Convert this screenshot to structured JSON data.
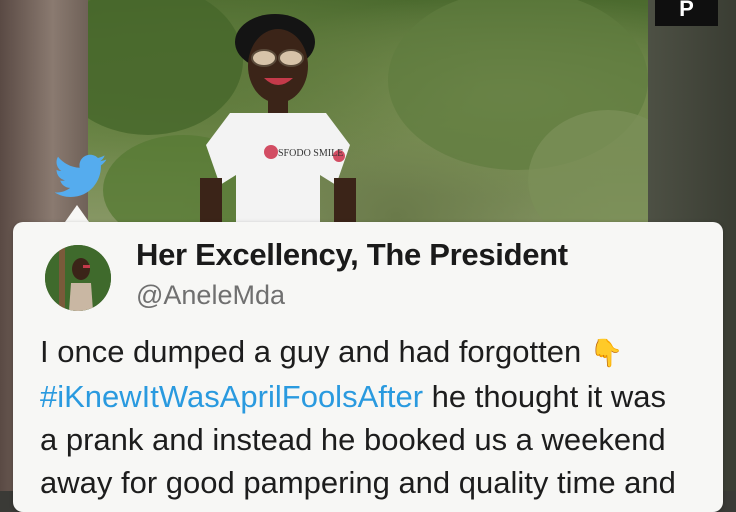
{
  "header_badge": {
    "label": "P"
  },
  "tweet": {
    "display_name": "Her Excellency, The President",
    "handle": "@AneleMda",
    "lines": [
      {
        "text": "I once dumped a guy and had forgotten ",
        "emoji": "👇"
      },
      {
        "hashtag": "#iKnewItWasAprilFoolsAfter",
        "text": " he thought it was"
      },
      {
        "text": "a prank and instead he booked us a weekend"
      },
      {
        "text": "away for good pampering and quality time and"
      }
    ]
  },
  "shirt_print": "SFODO SMILE",
  "colors": {
    "twitter_blue": "#55acee",
    "hashtag": "#2a9adf",
    "card_bg": "#f7f7f5",
    "name": "#1a1a1a",
    "handle": "#707070"
  },
  "icons": [
    "twitter-bird-icon",
    "pointing-down-emoji"
  ]
}
